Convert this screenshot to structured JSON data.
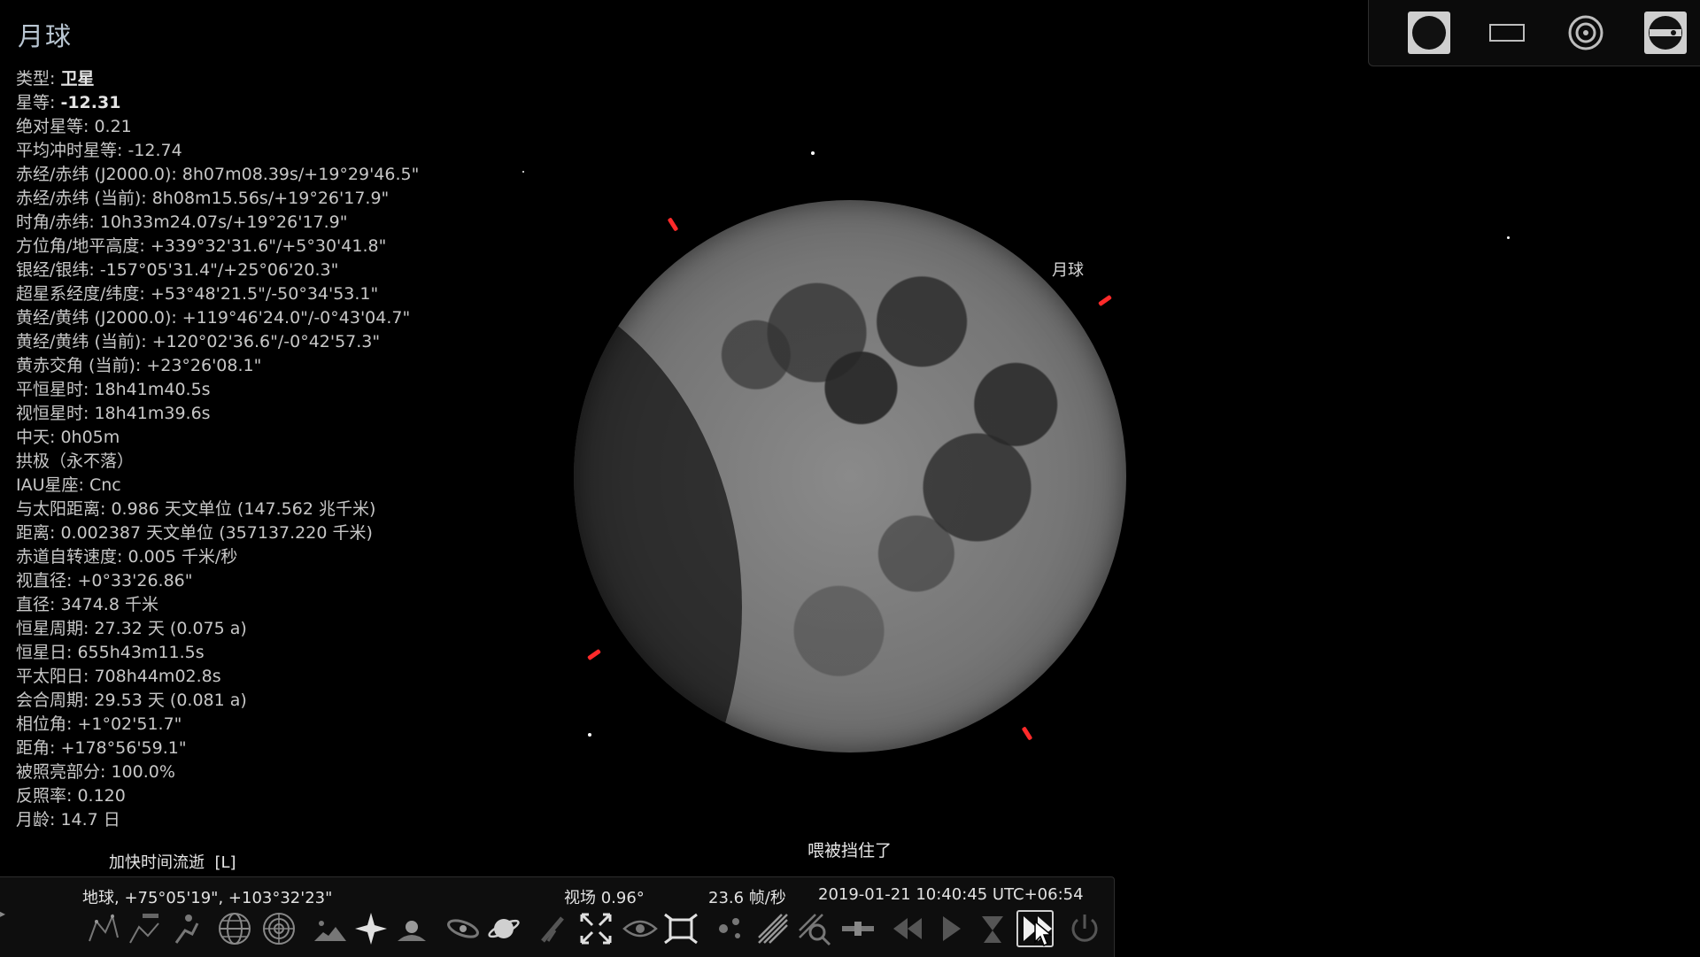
{
  "object": {
    "title": "月球",
    "info": [
      {
        "label": "类型: ",
        "value": "卫星",
        "strong": true
      },
      {
        "label": "星等: ",
        "value": "-12.31",
        "strong": true
      },
      {
        "label": "绝对星等: ",
        "value": "0.21"
      },
      {
        "label": "平均冲时星等: ",
        "value": "-12.74"
      },
      {
        "label": "赤经/赤纬 (J2000.0): ",
        "value": "8h07m08.39s/+19°29'46.5\""
      },
      {
        "label": "赤经/赤纬 (当前): ",
        "value": "8h08m15.56s/+19°26'17.9\""
      },
      {
        "label": "时角/赤纬: ",
        "value": "10h33m24.07s/+19°26'17.9\""
      },
      {
        "label": "方位角/地平高度: ",
        "value": "+339°32'31.6\"/+5°30'41.8\""
      },
      {
        "label": "银经/银纬: ",
        "value": "-157°05'31.4\"/+25°06'20.3\""
      },
      {
        "label": "超星系经度/纬度: ",
        "value": "+53°48'21.5\"/-50°34'53.1\""
      },
      {
        "label": "黄经/黄纬 (J2000.0): ",
        "value": "+119°46'24.0\"/-0°43'04.7\""
      },
      {
        "label": "黄经/黄纬 (当前): ",
        "value": "+120°02'36.6\"/-0°42'57.3\""
      },
      {
        "label": "黄赤交角 (当前): ",
        "value": "+23°26'08.1\""
      },
      {
        "label": "平恒星时: ",
        "value": "18h41m40.5s"
      },
      {
        "label": "视恒星时: ",
        "value": "18h41m39.6s"
      },
      {
        "label": "中天: ",
        "value": "0h05m"
      },
      {
        "label": "",
        "value": "拱极（永不落）"
      },
      {
        "label": "IAU星座: ",
        "value": "Cnc"
      },
      {
        "label": "与太阳距离: ",
        "value": "0.986 天文单位 (147.562 兆千米)"
      },
      {
        "label": "距离: ",
        "value": "0.002387 天文单位 (357137.220 千米)"
      },
      {
        "label": "赤道自转速度: ",
        "value": "0.005 千米/秒"
      },
      {
        "label": "视直径: ",
        "value": "+0°33'26.86\""
      },
      {
        "label": "直径: ",
        "value": "3474.8 千米"
      },
      {
        "label": "恒星周期: ",
        "value": "27.32 天 (0.075 a)"
      },
      {
        "label": "恒星日: ",
        "value": "655h43m11.5s"
      },
      {
        "label": "平太阳日: ",
        "value": "708h44m02.8s"
      },
      {
        "label": "会合周期: ",
        "value": "29.53 天 (0.081 a)"
      },
      {
        "label": "相位角: ",
        "value": "+1°02'51.7\""
      },
      {
        "label": "距角: ",
        "value": "+178°56'59.1\""
      },
      {
        "label": "被照亮部分: ",
        "value": "100.0%"
      },
      {
        "label": "反照率: ",
        "value": "0.120"
      },
      {
        "label": "月龄: ",
        "value": "14.7 日"
      }
    ]
  },
  "sky": {
    "moon_label": "月球",
    "hint": "喂被挡住了",
    "accelerate_tooltip": "加快时间流逝  [L]"
  },
  "status_bar": {
    "location": "地球, +75°05'19\", +103°32'23\"",
    "fov": "视场 0.96°",
    "fps": "23.6 帧/秒",
    "datetime": "2019-01-21 10:40:45 UTC+06:54"
  },
  "colors": {
    "target_marker": "#ff2a2a",
    "title": "#b9c6d2"
  }
}
